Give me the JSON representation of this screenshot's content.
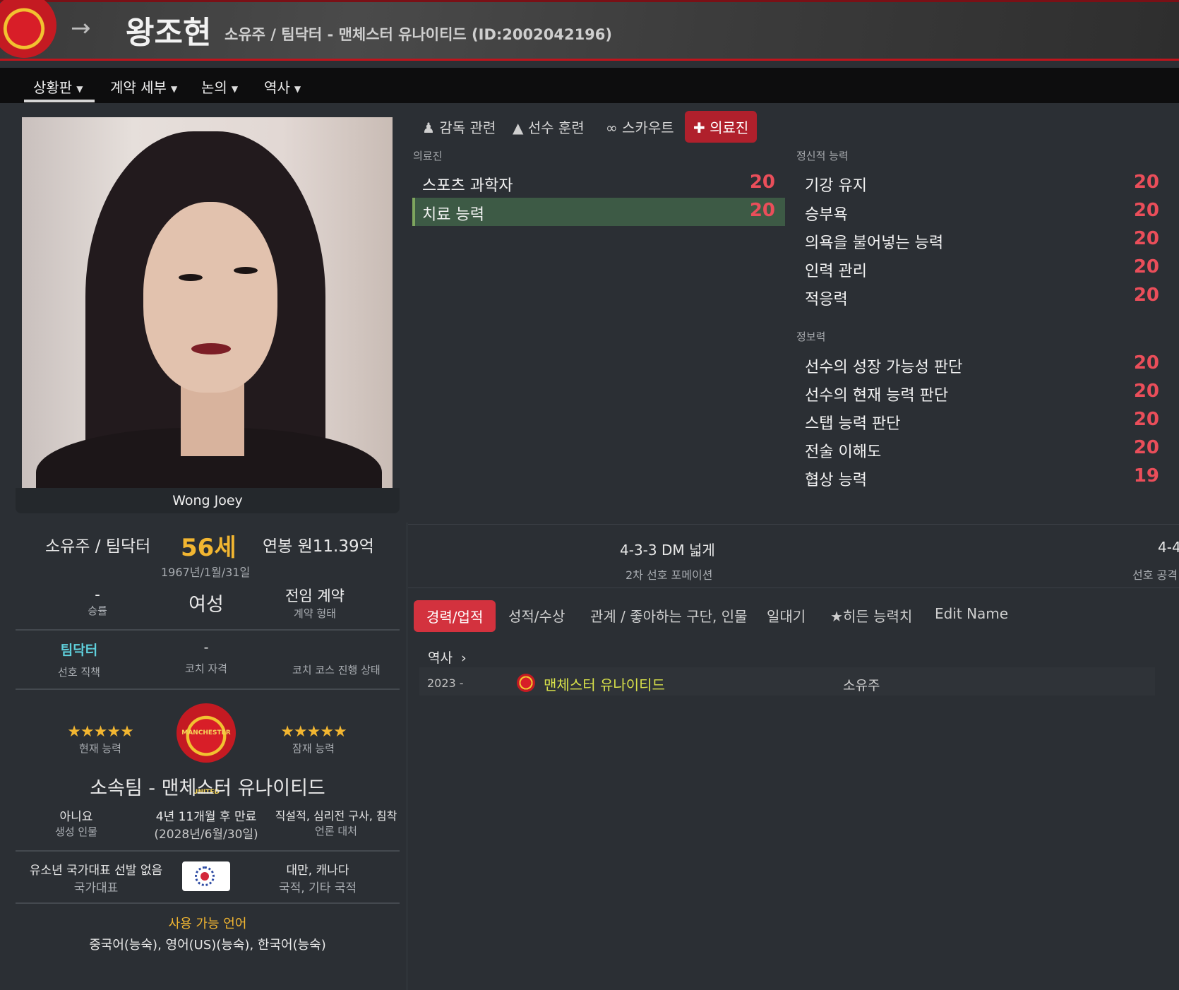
{
  "header": {
    "name": "왕조현",
    "subtitle": "소유주 / 팀닥터 - 맨체스터 유나이티드 (ID:2002042196)"
  },
  "nav": {
    "items": [
      {
        "label": "상황판"
      },
      {
        "label": "계약 세부"
      },
      {
        "label": "논의"
      },
      {
        "label": "역사"
      }
    ]
  },
  "photo": {
    "caption": "Wong Joey"
  },
  "profile": {
    "role": "소유주 / 팀닥터",
    "age": "56세",
    "salary": "연봉 원11.39억",
    "dob": "1967년/1월/31일",
    "win_rate_value": "-",
    "win_rate_label": "승률",
    "gender": "여성",
    "contract_value": "전임 계약",
    "contract_label": "계약 형태",
    "preferred_role_value": "팀닥터",
    "preferred_role_label": "선호 직책",
    "coach_license_value": "-",
    "coach_license_label": "코치 자격",
    "coach_course_label": "코치 코스 진행 상태",
    "current_ability_stars": "★★★★★",
    "current_ability_label": "현재 능력",
    "potential_ability_stars": "★★★★★",
    "potential_ability_label": "잠재 능력",
    "crest_text": "MANCHESTER UNITED",
    "club": "소속팀 - 맨체스터 유나이티드",
    "generated_value": "아니요",
    "generated_label": "생성 인물",
    "contract_end_value": "4년 11개월 후 만료",
    "contract_end_date": "(2028년/6월/30일)",
    "media_value": "직설적, 심리전 구사, 침착",
    "media_label": "언론 대처",
    "intl_value": "유소년 국가대표 선발 없음",
    "intl_label": "국가대표",
    "nationality_value": "대만, 캐나다",
    "nationality_label": "국적, 기타 국적",
    "languages_label": "사용 가능 언어",
    "languages_value": "중국어(능숙), 영어(US)(능숙), 한국어(능숙)"
  },
  "tabs": [
    {
      "label": "감독 관련",
      "icon": "person-icon"
    },
    {
      "label": "선수 훈련",
      "icon": "cone-icon"
    },
    {
      "label": "스카우트",
      "icon": "binoculars-icon"
    },
    {
      "label": "의료진",
      "icon": "medkit-icon"
    }
  ],
  "medical": {
    "section": "의료진",
    "attrs": [
      {
        "name": "스포츠 과학자",
        "value": "20"
      },
      {
        "name": "치료 능력",
        "value": "20"
      }
    ]
  },
  "mental": {
    "section": "정신적 능력",
    "attrs": [
      {
        "name": "기강 유지",
        "value": "20"
      },
      {
        "name": "승부욕",
        "value": "20"
      },
      {
        "name": "의욕을 불어넣는 능력",
        "value": "20"
      },
      {
        "name": "인력 관리",
        "value": "20"
      },
      {
        "name": "적응력",
        "value": "20"
      }
    ]
  },
  "knowledge": {
    "section": "정보력",
    "attrs": [
      {
        "name": "선수의 성장 가능성 판단",
        "value": "20"
      },
      {
        "name": "선수의 현재 능력 판단",
        "value": "20"
      },
      {
        "name": "스탭 능력 판단",
        "value": "20"
      },
      {
        "name": "전술 이해도",
        "value": "20"
      },
      {
        "name": "협상 능력",
        "value": "19"
      }
    ]
  },
  "formation": {
    "second_value": "4-3-3 DM 넓게",
    "second_label": "2차 선호 포메이션",
    "attack_value": "4-4",
    "attack_label": "선호 공격"
  },
  "bottom_tabs": [
    {
      "label": "경력/업적"
    },
    {
      "label": "성적/수상"
    },
    {
      "label": "관계 / 좋아하는 구단, 인물"
    },
    {
      "label": "일대기"
    },
    {
      "label": "★히든 능력치"
    },
    {
      "label": "Edit Name"
    }
  ],
  "history": {
    "title": "역사",
    "rows": [
      {
        "year": "2023 -",
        "club": "맨체스터 유나이티드",
        "role": "소유주"
      }
    ]
  }
}
